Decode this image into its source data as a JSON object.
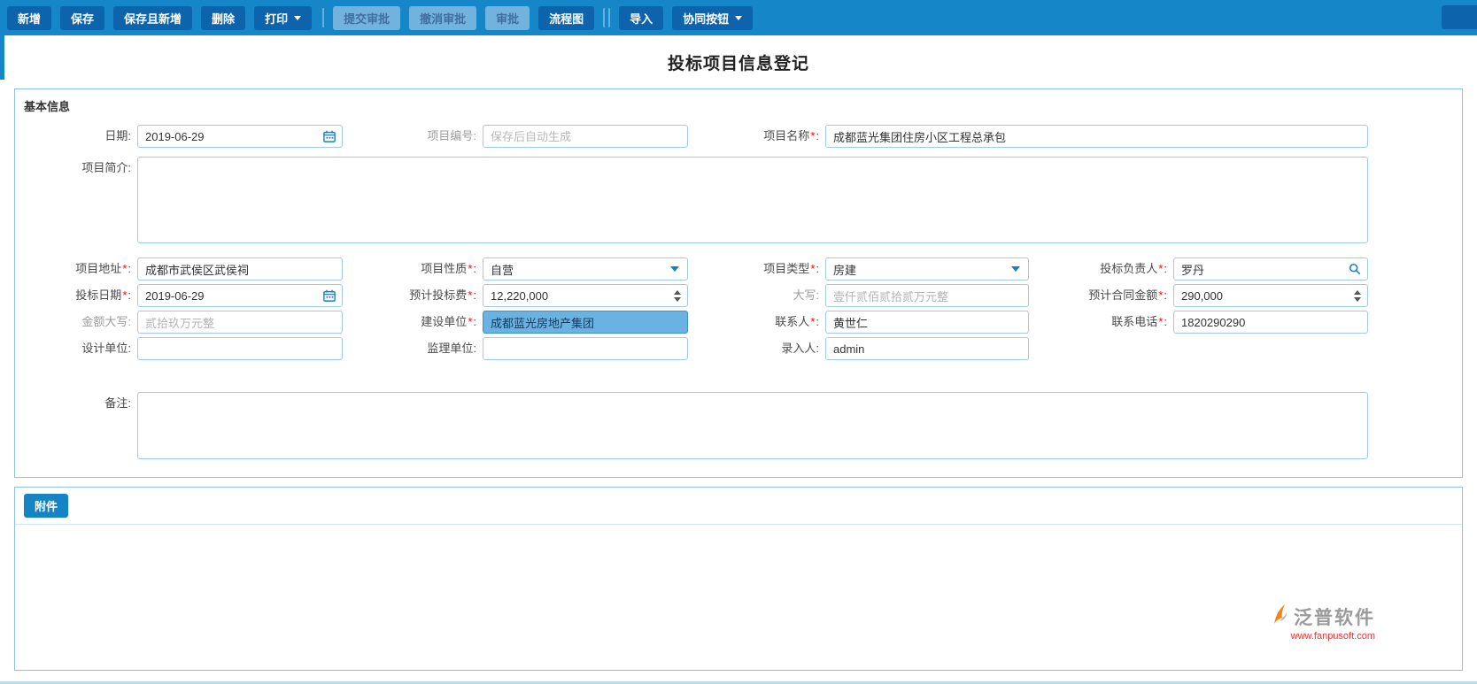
{
  "colors": {
    "toolbar_bg": "#1587c8",
    "button_bg": "#0d64ad",
    "disabled_button_bg": "#72b3de",
    "input_border": "#a3c9e8",
    "highlight_bg": "#69b2e2",
    "required_mark_color": "#ff0000",
    "brand_url_color": "#e23b3b"
  },
  "toolbar": {
    "new": "新增",
    "save": "保存",
    "save_and_new": "保存且新增",
    "delete": "删除",
    "print": "打印",
    "submit_approval": "提交审批",
    "cancel_approval": "撤消审批",
    "approve": "审批",
    "flowchart": "流程图",
    "import": "导入",
    "collab": "协同按钮"
  },
  "page": {
    "title": "投标项目信息登记"
  },
  "section": {
    "basic_info": "基本信息"
  },
  "required_mark": "*",
  "colon": ":",
  "fields": {
    "date": {
      "label": "日期:",
      "value": "2019-06-29"
    },
    "project_no": {
      "label": "项目编号:",
      "placeholder": "保存后自动生成"
    },
    "project_name": {
      "label": "项目名称",
      "value": "成都蓝光集团住房小区工程总承包"
    },
    "project_intro": {
      "label": "项目简介:",
      "value": ""
    },
    "project_address": {
      "label": "项目地址",
      "value": "成都市武侯区武侯祠"
    },
    "project_nature": {
      "label": "项目性质",
      "value": "自营"
    },
    "project_type": {
      "label": "项目类型",
      "value": "房建"
    },
    "bid_leader": {
      "label": "投标负责人",
      "value": "罗丹"
    },
    "bid_date": {
      "label": "投标日期",
      "value": "2019-06-29"
    },
    "bid_cost": {
      "label": "预计投标费",
      "value": "12,220,000"
    },
    "bid_cost_caps": {
      "label": "大写:",
      "value": "壹仟贰佰贰拾贰万元整"
    },
    "contract_amount": {
      "label": "预计合同金额",
      "value": "290,000"
    },
    "amount_caps": {
      "label": "金额大写:",
      "value": "贰拾玖万元整"
    },
    "construction_unit": {
      "label": "建设单位",
      "value": "成都蓝光房地产集团"
    },
    "contact": {
      "label": "联系人",
      "value": "黄世仁"
    },
    "phone": {
      "label": "联系电话",
      "value": "1820290290"
    },
    "design_unit": {
      "label": "设计单位:",
      "value": ""
    },
    "supervision_unit": {
      "label": "监理单位:",
      "value": ""
    },
    "entry_person": {
      "label": "录入人:",
      "value": "admin"
    },
    "remark": {
      "label": "备注:",
      "value": ""
    }
  },
  "attachment": {
    "button": "附件"
  },
  "footer": {
    "brand": "泛普软件",
    "url": "www.fanpusoft.com"
  }
}
